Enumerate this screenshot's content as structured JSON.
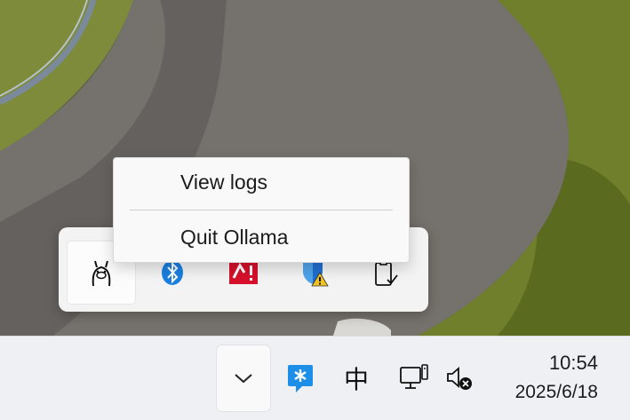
{
  "context_menu": {
    "items": [
      {
        "label": "View logs"
      },
      {
        "label": "Quit Ollama"
      }
    ]
  },
  "tray_overflow": {
    "icons": [
      {
        "name": "ollama-icon"
      },
      {
        "name": "bluetooth-icon"
      },
      {
        "name": "antivirus-alert-icon"
      },
      {
        "name": "security-warning-icon"
      },
      {
        "name": "clipboard-check-icon"
      }
    ]
  },
  "taskbar": {
    "chevron_icon": "chevron-down-icon",
    "ime_label": "中",
    "clock": {
      "time": "10:54",
      "date": "2025/6/18"
    }
  },
  "colors": {
    "bluetooth": "#1a7fe0",
    "alert_red": "#d6102a",
    "shield_blue": "#1f6fd1",
    "warning_yellow": "#f3c21b",
    "taskbar_bg": "#eef0f3"
  }
}
